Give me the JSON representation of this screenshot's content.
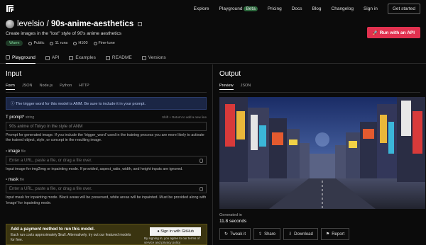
{
  "nav": {
    "explore": "Explore",
    "playground": "Playground",
    "beta": "Beta",
    "pricing": "Pricing",
    "docs": "Docs",
    "blog": "Blog",
    "changelog": "Changelog",
    "signin": "Sign in",
    "get_started": "Get started"
  },
  "model": {
    "owner": "levelsio",
    "sep": "/",
    "name": "90s-anime-aesthetics",
    "description": "Create images in the \"lost\" style of 90's anime aesthetics",
    "status": "Warm",
    "visibility": "Public",
    "runs": "11 runs",
    "hardware": "H100",
    "finetune": "Fine-tune"
  },
  "run_api": "Run with an API",
  "tabs": [
    "Playground",
    "API",
    "Examples",
    "README",
    "Versions"
  ],
  "input": {
    "title": "Input",
    "subtabs": [
      "Form",
      "JSON",
      "Node.js",
      "Python",
      "HTTP"
    ],
    "notice": "The trigger word for this model is ANM. Be sure to include it in your prompt.",
    "prompt_label": "prompt*",
    "prompt_type": "string",
    "prompt_hint": "Shift + Return to add a new line",
    "prompt_value": "90s anime of Tokyo in the style of ANM",
    "prompt_desc": "Prompt for generated image. If you include the 'trigger_word' used in the training process you are more likely to activate the trained object, style, or concept in the resulting image.",
    "image_label": "image",
    "image_type": "file",
    "image_placeholder": "Enter a URL, paste a file, or drag a file over.",
    "image_desc": "Input image for img2img or inpainting mode. If provided, aspect_ratio, width, and height inputs are ignored.",
    "mask_label": "mask",
    "mask_type": "file",
    "mask_placeholder": "Enter a URL, paste a file, or drag a file over.",
    "mask_desc": "Input mask for inpainting mode. Black areas will be preserved, white areas will be inpainted. Must be provided along with 'image' for inpainting mode."
  },
  "payment": {
    "title": "Add a payment method to run this model.",
    "desc": "Each run costs approximately $null. Alternatively, try out our featured models for free.",
    "github_button": "Sign in with GitHub",
    "github_note": "By signing in, you agree to our terms of service and privacy policy"
  },
  "output": {
    "title": "Output",
    "subtabs": [
      "Preview",
      "JSON"
    ],
    "generated_label": "Generated in",
    "generated_value": "11.8 seconds",
    "actions": [
      "Tweak it",
      "Share",
      "Download",
      "Report"
    ]
  }
}
